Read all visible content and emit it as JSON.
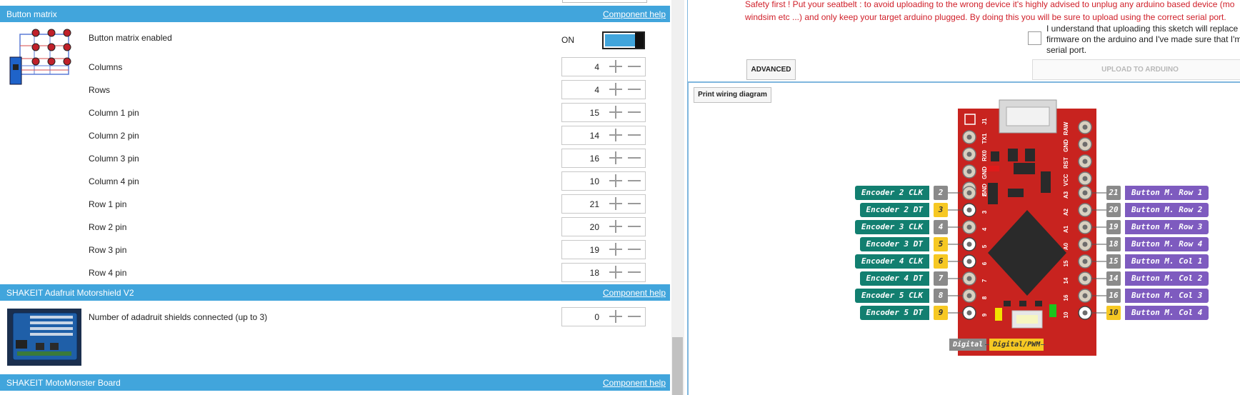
{
  "left_panel": {
    "button_matrix": {
      "header": "Button matrix",
      "help": "Component help",
      "enabled_label": "Button matrix enabled",
      "toggle_state": "ON",
      "rows": [
        {
          "label": "Columns",
          "value": "4"
        },
        {
          "label": "Rows",
          "value": "4"
        },
        {
          "label": "Column 1 pin",
          "value": "15"
        },
        {
          "label": "Column 2 pin",
          "value": "14"
        },
        {
          "label": "Column 3 pin",
          "value": "16"
        },
        {
          "label": "Column 4 pin",
          "value": "10"
        },
        {
          "label": "Row 1 pin",
          "value": "21"
        },
        {
          "label": "Row 2 pin",
          "value": "20"
        },
        {
          "label": "Row 3 pin",
          "value": "19"
        },
        {
          "label": "Row 4 pin",
          "value": "18"
        }
      ]
    },
    "motorshield": {
      "header": "SHAKEIT Adafruit Motorshield V2",
      "help": "Component help",
      "count_label": "Number of adadruit shields connected (up to 3)",
      "count_value": "0"
    },
    "motomonster": {
      "header": "SHAKEIT MotoMonster Board",
      "help": "Component help"
    }
  },
  "right_panel": {
    "warning_lines": [
      "Safety first ! Put your seatbelt : to avoid uploading to the wrong device it's highly advised to unplug any arduino based device (mo",
      "windsim etc ...) and only keep your target arduino plugged. By doing this you will be sure to upload using the correct serial port."
    ],
    "confirm_text": "I understand that uploading this sketch will replace firmware on the arduino and I've made sure that I'm serial port.",
    "advanced_label": "ADVANCED",
    "upload_label": "UPLOAD TO ARDUINO",
    "print_label": "Print wiring diagram"
  },
  "board": {
    "left_header_labels": [
      "J1",
      "TX1",
      "RX0",
      "GND",
      "GND"
    ],
    "right_header_labels": [
      "RAW",
      "GND",
      "RST",
      "VCC"
    ],
    "left_pins": [
      {
        "num": "2",
        "label": "Encoder 2 CLK",
        "kind": "gray"
      },
      {
        "num": "3",
        "label": "Encoder 2 DT",
        "kind": "yellow"
      },
      {
        "num": "4",
        "label": "Encoder 3 CLK",
        "kind": "gray"
      },
      {
        "num": "5",
        "label": "Encoder 3 DT",
        "kind": "yellow"
      },
      {
        "num": "6",
        "label": "Encoder 4 CLK",
        "kind": "yellow"
      },
      {
        "num": "7",
        "label": "Encoder 4 DT",
        "kind": "gray"
      },
      {
        "num": "8",
        "label": "Encoder 5 CLK",
        "kind": "gray"
      },
      {
        "num": "9",
        "label": "Encoder 5 DT",
        "kind": "yellow"
      }
    ],
    "right_pins": [
      {
        "silk": "A3",
        "num": "21",
        "label": "Button M. Row 1",
        "kind": "gray"
      },
      {
        "silk": "A2",
        "num": "20",
        "label": "Button M. Row 2",
        "kind": "gray"
      },
      {
        "silk": "A1",
        "num": "19",
        "label": "Button M. Row 3",
        "kind": "gray"
      },
      {
        "silk": "A0",
        "num": "18",
        "label": "Button M. Row 4",
        "kind": "gray"
      },
      {
        "silk": "15",
        "num": "15",
        "label": "Button M. Col 1",
        "kind": "gray"
      },
      {
        "silk": "14",
        "num": "14",
        "label": "Button M. Col 2",
        "kind": "gray"
      },
      {
        "silk": "16",
        "num": "16",
        "label": "Button M. Col 3",
        "kind": "gray"
      },
      {
        "silk": "10",
        "num": "10",
        "label": "Button M. Col 4",
        "kind": "yellow"
      }
    ],
    "legend": {
      "digital": "Digital",
      "pwm": "Digital/PWM"
    },
    "colors": {
      "pcb": "#c8231f",
      "teal": "#127f70",
      "purple": "#7e5bbf",
      "gray": "#8a8a8a",
      "yellow": "#f6c823",
      "accent": "#41a5dc"
    }
  }
}
